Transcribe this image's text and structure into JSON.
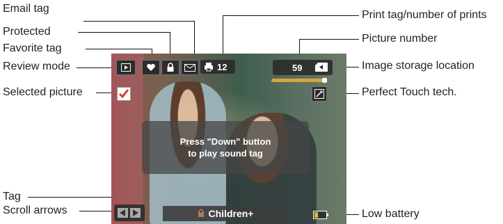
{
  "callouts": {
    "email_tag": "Email tag",
    "protected": "Protected",
    "favorite_tag": "Favorite tag",
    "review_mode": "Review mode",
    "selected_picture": "Selected picture",
    "tag": "Tag",
    "scroll_arrows": "Scroll arrows",
    "print_tag": "Print tag/number of prints",
    "picture_number": "Picture number",
    "image_storage": "Image storage location",
    "perfect_touch": "Perfect Touch tech.",
    "low_battery": "Low battery"
  },
  "screen": {
    "print_count": "12",
    "picture_number": "59",
    "message_line1": "Press \"Down\" button",
    "message_line2": "to play sound tag",
    "tag_label": "Children+"
  },
  "colors": {
    "checkbox_red": "#d83a3a",
    "progress": "#d9a53a"
  },
  "icons": {
    "review": "play-icon",
    "favorite": "heart-icon",
    "protected": "lock-icon",
    "email": "envelope-icon",
    "print": "printer-icon",
    "storage": "memory-card-icon",
    "perfect_touch": "perfect-touch-icon",
    "selected": "checkbox-icon",
    "scroll": "arrow-icons",
    "battery": "battery-icon"
  }
}
